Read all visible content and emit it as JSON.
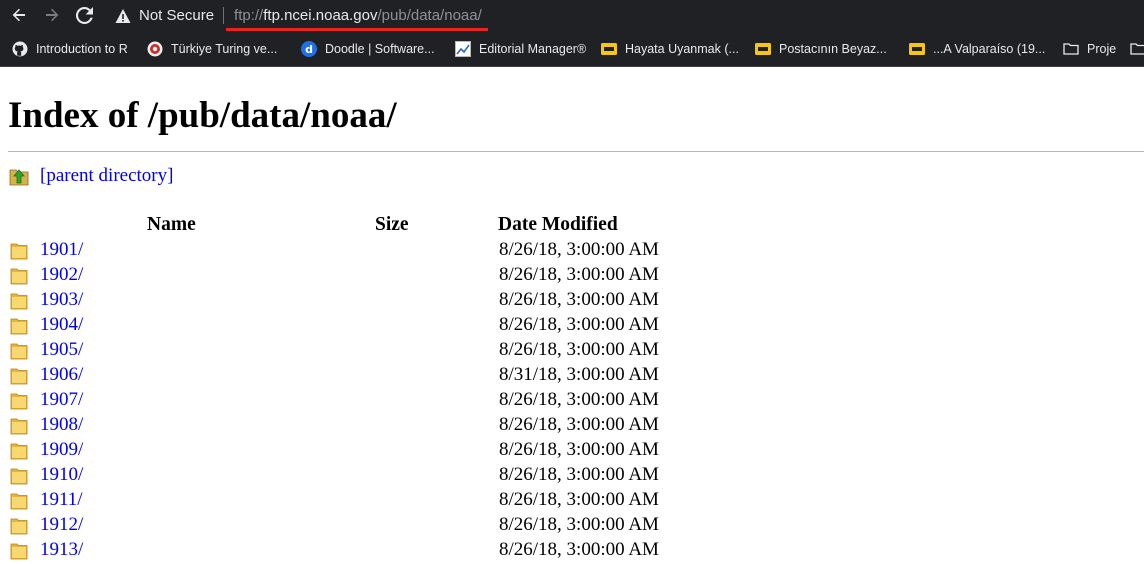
{
  "browser": {
    "security_label": "Not Secure",
    "url": {
      "scheme": "ftp://",
      "host": "ftp.ncei.noaa.gov",
      "path": "/pub/data/noaa/"
    },
    "bookmarks": [
      {
        "label": "Introduction to R",
        "icon": "github-icon"
      },
      {
        "label": "Türkiye Turing ve...",
        "icon": "turing-logo-icon"
      },
      {
        "label": "Doodle | Software...",
        "icon": "doodle-icon"
      },
      {
        "label": "Editorial Manager®",
        "icon": "chart-icon"
      },
      {
        "label": "Hayata Uyanmak (...",
        "icon": "bookmark-yellow-icon"
      },
      {
        "label": "Postacının Beyaz...",
        "icon": "bookmark-yellow-icon"
      },
      {
        "label": "...A Valparaíso (19...",
        "icon": "bookmark-yellow-icon"
      },
      {
        "label": "Proje",
        "icon": "folder-icon"
      }
    ]
  },
  "page": {
    "title": "Index of /pub/data/noaa/",
    "parent_link": "[parent directory]",
    "columns": {
      "name": "Name",
      "size": "Size",
      "date": "Date Modified"
    },
    "entries": [
      {
        "name": "1901/",
        "size": "",
        "date": "8/26/18, 3:00:00 AM"
      },
      {
        "name": "1902/",
        "size": "",
        "date": "8/26/18, 3:00:00 AM"
      },
      {
        "name": "1903/",
        "size": "",
        "date": "8/26/18, 3:00:00 AM"
      },
      {
        "name": "1904/",
        "size": "",
        "date": "8/26/18, 3:00:00 AM"
      },
      {
        "name": "1905/",
        "size": "",
        "date": "8/26/18, 3:00:00 AM"
      },
      {
        "name": "1906/",
        "size": "",
        "date": "8/31/18, 3:00:00 AM"
      },
      {
        "name": "1907/",
        "size": "",
        "date": "8/26/18, 3:00:00 AM"
      },
      {
        "name": "1908/",
        "size": "",
        "date": "8/26/18, 3:00:00 AM"
      },
      {
        "name": "1909/",
        "size": "",
        "date": "8/26/18, 3:00:00 AM"
      },
      {
        "name": "1910/",
        "size": "",
        "date": "8/26/18, 3:00:00 AM"
      },
      {
        "name": "1911/",
        "size": "",
        "date": "8/26/18, 3:00:00 AM"
      },
      {
        "name": "1912/",
        "size": "",
        "date": "8/26/18, 3:00:00 AM"
      },
      {
        "name": "1913/",
        "size": "",
        "date": "8/26/18, 3:00:00 AM"
      }
    ]
  },
  "colors": {
    "chrome_bg": "#202124",
    "link": "#0000ee",
    "url_underline": "#e8251d",
    "folder": "#f2c84b"
  }
}
